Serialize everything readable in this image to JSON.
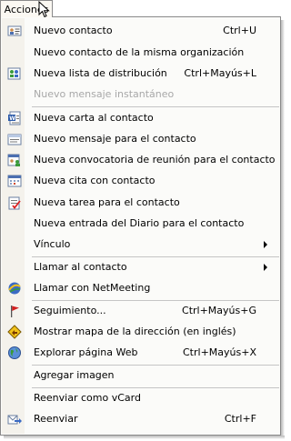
{
  "menu_button": {
    "label": "Acciones"
  },
  "items": [
    {
      "id": "nuevo-contacto",
      "label": "Nuevo contacto",
      "shortcut": "Ctrl+U"
    },
    {
      "id": "nuevo-contacto-org",
      "label": "Nuevo contacto de la misma organización",
      "shortcut": ""
    },
    {
      "id": "nueva-lista",
      "label": "Nueva lista de distribución",
      "shortcut": "Ctrl+Mayús+L"
    },
    {
      "id": "nuevo-mensaje-instantaneo",
      "label": "Nuevo mensaje instantáneo",
      "shortcut": "",
      "disabled": true
    },
    {
      "id": "nueva-carta",
      "label": "Nueva carta al contacto",
      "shortcut": ""
    },
    {
      "id": "nuevo-mensaje",
      "label": "Nuevo mensaje para el contacto",
      "shortcut": ""
    },
    {
      "id": "nueva-convocatoria",
      "label": "Nueva convocatoria de reunión para el contacto",
      "shortcut": ""
    },
    {
      "id": "nueva-cita",
      "label": "Nueva cita con contacto",
      "shortcut": ""
    },
    {
      "id": "nueva-tarea",
      "label": "Nueva tarea para el contacto",
      "shortcut": ""
    },
    {
      "id": "nueva-entrada-diario",
      "label": "Nueva entrada del Diario para el contacto",
      "shortcut": ""
    },
    {
      "id": "vinculo",
      "label": "Vínculo",
      "shortcut": "",
      "submenu": true
    },
    {
      "id": "llamar-contacto",
      "label": "Llamar al contacto",
      "shortcut": "",
      "submenu": true
    },
    {
      "id": "llamar-netmeeting",
      "label": "Llamar con NetMeeting",
      "shortcut": ""
    },
    {
      "id": "seguimiento",
      "label": "Seguimiento...",
      "shortcut": "Ctrl+Mayús+G"
    },
    {
      "id": "mostrar-mapa",
      "label": "Mostrar mapa de la dirección (en inglés)",
      "shortcut": ""
    },
    {
      "id": "explorar-web",
      "label": "Explorar página Web",
      "shortcut": "Ctrl+Mayús+X"
    },
    {
      "id": "agregar-imagen",
      "label": "Agregar imagen",
      "shortcut": ""
    },
    {
      "id": "reenviar-vcard",
      "label": "Reenviar como vCard",
      "shortcut": ""
    },
    {
      "id": "reenviar",
      "label": "Reenviar",
      "shortcut": "Ctrl+F"
    }
  ]
}
